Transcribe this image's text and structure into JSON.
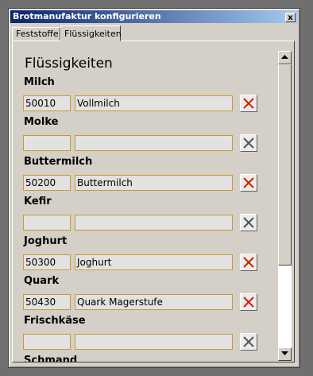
{
  "window": {
    "title": "Brotmanufaktur konfigurieren",
    "close_symbol": "x"
  },
  "tabs": [
    {
      "label": "Feststoffe",
      "active": false
    },
    {
      "label": "Flüssigkeiten",
      "active": true
    }
  ],
  "section_title": "Flüssigkeiten",
  "rows": [
    {
      "label": "Milch",
      "code": "50010",
      "name": "Vollmilch",
      "delete_active": true
    },
    {
      "label": "Molke",
      "code": "",
      "name": "",
      "delete_active": false
    },
    {
      "label": "Buttermilch",
      "code": "50200",
      "name": "Buttermilch",
      "delete_active": true
    },
    {
      "label": "Kefir",
      "code": "",
      "name": "",
      "delete_active": false
    },
    {
      "label": "Joghurt",
      "code": "50300",
      "name": "Joghurt",
      "delete_active": true
    },
    {
      "label": "Quark",
      "code": "50430",
      "name": "Quark Magerstufe",
      "delete_active": true
    },
    {
      "label": "Frischkäse",
      "code": "",
      "name": "",
      "delete_active": false
    },
    {
      "label": "Schmand",
      "code": "",
      "name": "",
      "delete_active": false
    }
  ],
  "icons": {
    "delete_active": "red-x-icon",
    "delete_inactive": "gray-x-icon"
  },
  "colors": {
    "title_bar_start": "#0a246a",
    "title_bar_end": "#a6caf0",
    "field_border": "#c89a30",
    "delete_active": "#cc2200",
    "delete_inactive": "#555555"
  }
}
